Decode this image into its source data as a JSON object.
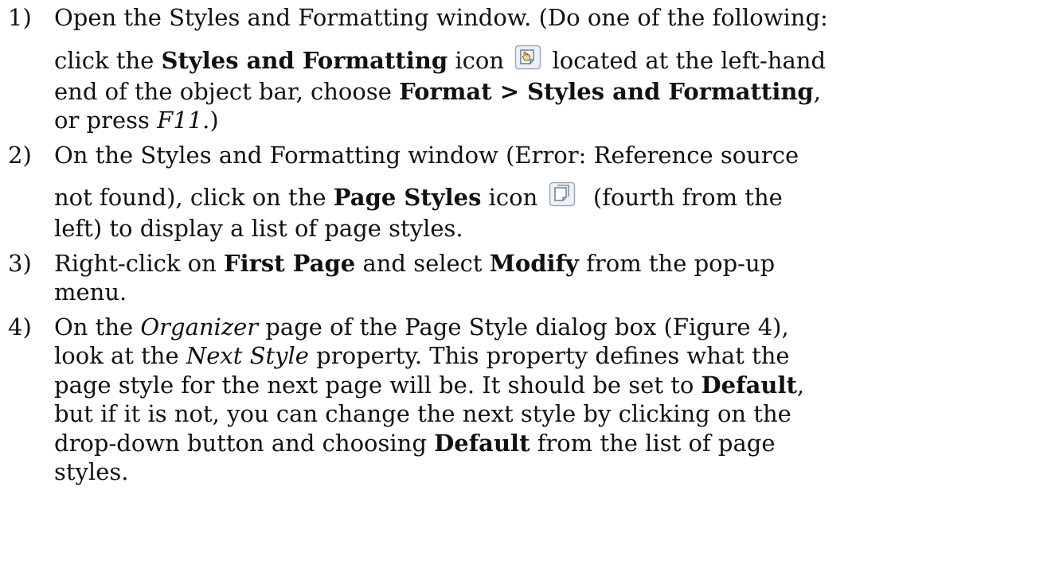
{
  "steps": [
    {
      "number": "1)",
      "line1": "Open the Styles and Formatting window. (Do one of the following:",
      "line2_pre": "click the ",
      "line2_bold": "Styles and Formatting",
      "line2_mid": " icon",
      "line2_post": " located at the left-hand",
      "line3_pre": "end of the object bar, choose ",
      "line3_bold": "Format > Styles and Formatting",
      "line3_post": ",",
      "line4_pre": "or press ",
      "line4_italic": "F11",
      "line4_post": ".)",
      "icon": "styles-and-formatting-icon"
    },
    {
      "number": "2)",
      "line1": "On the Styles and Formatting window (Error: Reference source",
      "line2_pre": "not found), click on the ",
      "line2_bold": "Page Styles",
      "line2_mid": " icon",
      "line2_post": "  (fourth from the",
      "line3": "left) to display a list of page styles.",
      "icon": "page-styles-icon"
    },
    {
      "number": "3)",
      "line1_pre": "Right-click on ",
      "line1_bold1": "First Page",
      "line1_mid": " and select ",
      "line1_bold2": "Modify",
      "line1_post": " from the pop-up",
      "line2": "menu."
    },
    {
      "number": "4)",
      "line1_pre": "On the ",
      "line1_italic": "Organizer",
      "line1_post": " page of the Page Style dialog box (Figure 4),",
      "line2_pre": "look at the ",
      "line2_italic": "Next Style",
      "line2_post": " property. This property defines what the",
      "line3_pre": "page style for the next page will be. It should be set to ",
      "line3_bold": "Default",
      "line3_post": ",",
      "line4": "but if it is not, you can change the next style by clicking on the",
      "line5_pre": "drop-down button and choosing ",
      "line5_bold": "Default",
      "line5_post": " from the list of page",
      "line6": "styles."
    }
  ],
  "colors": {
    "text": "#111111",
    "icon_border": "#7f9db9",
    "icon_fill": "#f4f6f8"
  }
}
